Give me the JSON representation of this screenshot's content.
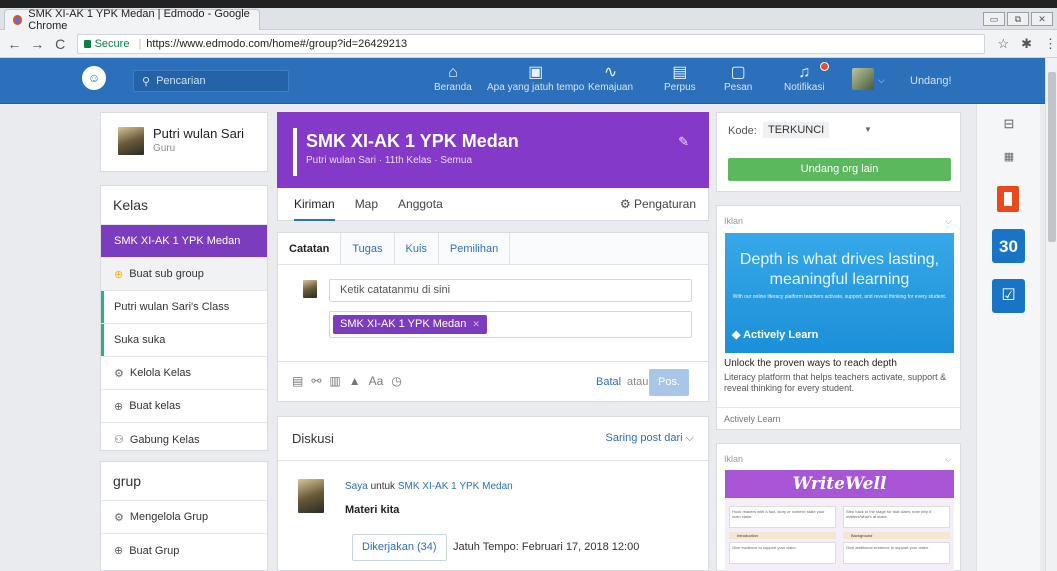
{
  "browser": {
    "tab_title": "SMK XI-AK 1 YPK Medan | Edmodo - Google Chrome",
    "secure_label": "Secure",
    "url": "https://www.edmodo.com/home#/group?id=26429213"
  },
  "nav": {
    "search_placeholder": "Pencarian",
    "items": [
      {
        "label": "Beranda",
        "icon": "home-icon"
      },
      {
        "label": "Apa yang jatuh tempo",
        "icon": "due-icon"
      },
      {
        "label": "Kemajuan",
        "icon": "progress-icon"
      },
      {
        "label": "Perpus",
        "icon": "library-icon"
      },
      {
        "label": "Pesan",
        "icon": "message-icon"
      },
      {
        "label": "Notifikasi",
        "icon": "notification-icon"
      }
    ],
    "invite": "Undang!"
  },
  "profile": {
    "name": "Putri wulan Sari",
    "role": "Guru"
  },
  "kelas": {
    "heading": "Kelas",
    "items": [
      {
        "label": "SMK XI-AK 1 YPK Medan"
      },
      {
        "label": "Buat sub group"
      },
      {
        "label": "Putri wulan Sari's Class"
      },
      {
        "label": "Suka suka"
      },
      {
        "label": "Kelola Kelas"
      },
      {
        "label": "Buat kelas"
      },
      {
        "label": "Gabung Kelas"
      }
    ]
  },
  "grup": {
    "heading": "grup",
    "items": [
      {
        "label": "Mengelola Grup"
      },
      {
        "label": "Buat Grup"
      }
    ]
  },
  "group": {
    "title": "SMK XI-AK 1 YPK Medan",
    "subtitle": "Putri wulan Sari · 11th Kelas · Semua",
    "color": "#8439c9",
    "tabs": [
      "Kiriman",
      "Map",
      "Anggota"
    ],
    "settings": "Pengaturan"
  },
  "composer": {
    "tabs": [
      "Catatan",
      "Tugas",
      "Kuis",
      "Pemilihan"
    ],
    "note_placeholder": "Ketik catatanmu di sini",
    "recipient_chip": "SMK XI-AK 1 YPK Medan",
    "tool_text": "Aa",
    "cancel": "Batal",
    "or": "atau",
    "post": "Pos."
  },
  "discussion": {
    "heading": "Diskusi",
    "filter": "Saring post dari",
    "post": {
      "author": "Saya",
      "for_text": "untuk",
      "group": "SMK XI-AK 1 YPK Medan",
      "title": "Materi kita",
      "done_button": "Dikerjakan (34)",
      "due": "Jatuh Tempo: Februari 17, 2018 12:00"
    }
  },
  "code": {
    "label": "Kode:",
    "value": "TERKUNCI",
    "invite_button": "Undang org lain"
  },
  "ads": [
    {
      "label": "Iklan",
      "headline": "Depth is what drives lasting, meaningful learning",
      "subline": "With our online literacy platform teachers activate, support, and reveal thinking for every student.",
      "brand": "Actively Learn",
      "title": "Unlock the proven ways to reach depth",
      "desc": "Literacy platform that helps teachers activate, support & reveal thinking for every student.",
      "source": "Actively Learn"
    },
    {
      "label": "Iklan",
      "brand": "WriteWell",
      "box1": "Hook readers with a fact, story or context; state your main claim.",
      "box2": "Step back to the stage for that claim; note why it matters/what's at stake.",
      "lab1": "Introduction",
      "lab2": "Background",
      "box3": "Give evidence to support your claim.",
      "box4": "Give additional evidence to support your claim."
    }
  ],
  "rightbar": {
    "calendar_number": "30"
  }
}
